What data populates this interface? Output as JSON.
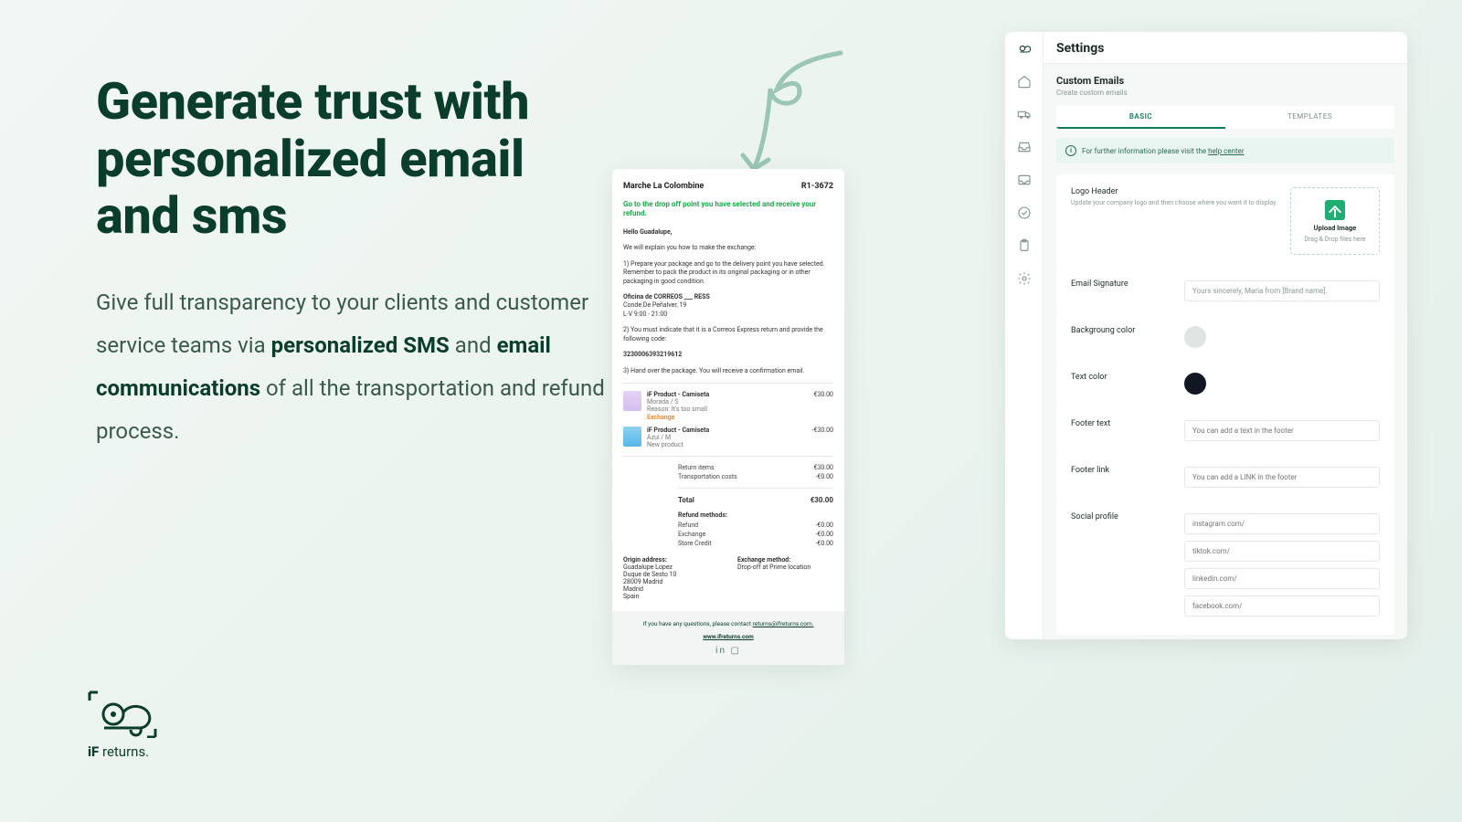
{
  "headline_l1": "Generate trust with",
  "headline_l2": "personalized email",
  "headline_l3": "and sms",
  "body_before": "Give full transparency to your clients and customer service teams via ",
  "body_bold1": "personalized SMS",
  "body_mid": " and ",
  "body_bold2": "email communications",
  "body_after": " of all the transportation and refund process.",
  "brand_if": "iF",
  "brand_word": " returns.",
  "email": {
    "merchant": "Marche La Colombine",
    "ref": "R1-3672",
    "action": "Go to the drop off point you have selected and receive your refund.",
    "greeting": "Hello Guadalupe,",
    "intro": "We will explain you how to make the exchange:",
    "step1": "1) Prepare your package and go to the delivery point you have selected. Remember to pack the product in its original packaging or in other packaging in good condition.",
    "office_name": "Oficina de CORREOS ___ RESS",
    "office_addr": "Conde De Peñalver, 19",
    "office_hours": "L-V 9:00 - 21:00",
    "step2": "2) You must indicate that it is a Correos Express return and provide the following code:",
    "code": "3230006393219612",
    "step3": "3) Hand over the package. You will receive a confirmation email.",
    "products": [
      {
        "name": "iF Product - Camiseta",
        "variant": "Morada / S",
        "reason": "Reason: It's too small",
        "tag": "Exchange",
        "price": "€30.00"
      },
      {
        "name": "iF Product - Camiseta",
        "variant": "Azul / M",
        "reason": "New product",
        "tag": "",
        "price": "-€30.00"
      }
    ],
    "line_return_items": "Return items",
    "line_return_items_val": "€30.00",
    "line_transport": "Transportation costs",
    "line_transport_val": "-€0.00",
    "line_total": "Total",
    "line_total_val": "€30.00",
    "methods_h": "Refund methods:",
    "m_refund": "Refund",
    "m_refund_v": "-€0.00",
    "m_exchange": "Exchange",
    "m_exchange_v": "-€0.00",
    "m_store": "Store Credit",
    "m_store_v": "-€0.00",
    "origin_h": "Origin address:",
    "origin_1": "Guadalupe Lopez",
    "origin_2": "Duque de Sesto 10",
    "origin_3": "28009 Madrid",
    "origin_4": "Madrid",
    "origin_5": "Spain",
    "exch_h": "Exchange method:",
    "exch_v": "Drop-off at Prime location",
    "footer_q": "If you have any questions, please contact ",
    "footer_mail": "returns@ifreturns.com.",
    "footer_site": "www.ifreturns.com"
  },
  "settings": {
    "title": "Settings",
    "section": "Custom Emails",
    "section_desc": "Create custom emails",
    "tab_basic": "BASIC",
    "tab_templates": "TEMPLATES",
    "info_before": "For further information please visit the ",
    "info_link": "help center",
    "logo_label": "Logo Header",
    "logo_desc": "Update your company logo and then choose where you want it to display.",
    "upload_t1": "Upload Image",
    "upload_t2": "Drag & Drop files here",
    "sig_label": "Email Signature",
    "sig_value": "Yours sincerely, Maria from [Brand name].",
    "bg_label": "Backgroung color",
    "txt_label": "Text color",
    "footer_text_label": "Footer text",
    "footer_text_ph": "You can add a text in the footer",
    "footer_link_label": "Footer link",
    "footer_link_ph": "You can add a LINK in the footer",
    "social_label": "Social profile",
    "social": [
      "instagram.com/",
      "tiktok.com/",
      "linkedin.com/",
      "facebook.com/"
    ]
  }
}
